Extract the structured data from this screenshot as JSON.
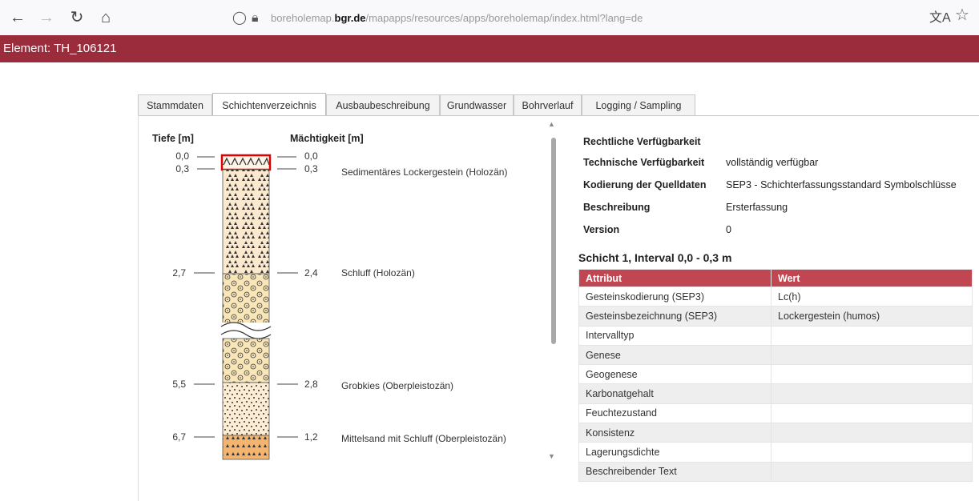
{
  "browser": {
    "url_prefix": "boreholemap.",
    "url_domain": "bgr.de",
    "url_path": "/mapapps/resources/apps/boreholemap/index.html?lang=de",
    "back_icon": "arrow-left-icon",
    "forward_icon": "arrow-right-icon",
    "reload_icon": "reload-icon",
    "home_icon": "home-icon"
  },
  "titlebar": {
    "title": "Element: TH_106121",
    "color": "#9b2c3c"
  },
  "tabs": [
    {
      "label": "Stammdaten",
      "active": false
    },
    {
      "label": "Schichtenverzeichnis",
      "active": true
    },
    {
      "label": "Ausbaubeschreibung",
      "active": false
    },
    {
      "label": "Grundwasser",
      "active": false
    },
    {
      "label": "Bohrverlauf",
      "active": false
    },
    {
      "label": "Logging / Sampling",
      "active": false
    }
  ],
  "profile": {
    "depth_header": "Tiefe [m]",
    "thickness_header": "Mächtigkeit [m]",
    "rows": [
      {
        "depth": "0,0",
        "thickness": "0,0",
        "description": ""
      },
      {
        "depth": "0,3",
        "thickness": "0,3",
        "description": "Sedimentäres Lockergestein (Holozän)"
      },
      {
        "depth": "2,7",
        "thickness": "2,4",
        "description": "Schluff (Holozän)"
      },
      {
        "depth": "5,5",
        "thickness": "2,8",
        "description": "Grobkies (Oberpleistozän)"
      },
      {
        "depth": "6,7",
        "thickness": "1,2",
        "description": "Mittelsand mit Schluff (Oberpleistozän)"
      }
    ]
  },
  "meta": [
    {
      "key": "Rechtliche Verfügbarkeit",
      "value": ""
    },
    {
      "key": "Technische Verfügbarkeit",
      "value": "vollständig verfügbar"
    },
    {
      "key": "Kodierung der Quelldaten",
      "value": "SEP3 - Schichterfassungsstandard Symbolschlüsse"
    },
    {
      "key": "Beschreibung",
      "value": "Ersterfassung"
    },
    {
      "key": "Version",
      "value": "0"
    }
  ],
  "layer": {
    "title": "Schicht 1, Interval 0,0 - 0,3 m",
    "col_attr": "Attribut",
    "col_value": "Wert",
    "rows": [
      {
        "attr": "Gesteinskodierung (SEP3)",
        "value": "Lc(h)"
      },
      {
        "attr": "Gesteinsbezeichnung (SEP3)",
        "value": "Lockergestein (humos)"
      },
      {
        "attr": "Intervalltyp",
        "value": ""
      },
      {
        "attr": "Genese",
        "value": ""
      },
      {
        "attr": "Geogenese",
        "value": ""
      },
      {
        "attr": "Karbonatgehalt",
        "value": ""
      },
      {
        "attr": "Feuchtezustand",
        "value": ""
      },
      {
        "attr": "Konsistenz",
        "value": ""
      },
      {
        "attr": "Lagerungsdichte",
        "value": ""
      },
      {
        "attr": "Beschreibender Text",
        "value": ""
      }
    ]
  }
}
